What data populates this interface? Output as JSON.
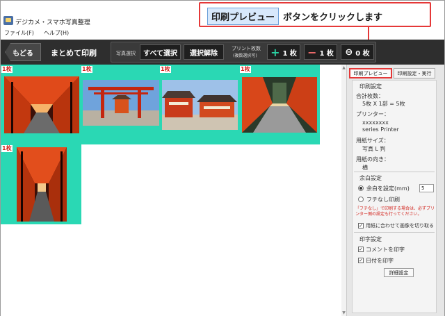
{
  "window": {
    "title": "デジカメ・スマホ写真整理"
  },
  "callout": {
    "button_label": "印刷プレビュー",
    "text": "ボタンをクリックします",
    "color": "#e53838"
  },
  "menu": [
    {
      "label": "ファイル(F)"
    },
    {
      "label": "ヘルプ(H)"
    }
  ],
  "toolbar": {
    "back_label": "もどる",
    "title": "まとめて印刷",
    "photo_select_label": "写真選択",
    "select_all": "すべて選択",
    "deselect": "選択解除",
    "print_count_label": "プリント枚数",
    "print_count_sub": "(複数選択可)",
    "plus_label": "1 枚",
    "minus_label": "1 枚",
    "zero_label": "0 枚",
    "plus_color": "#2ad0a2",
    "minus_color": "#f06c6c"
  },
  "thumbnails": [
    {
      "copies": "1枚",
      "scene": "torii-tunnel-1"
    },
    {
      "copies": "1枚",
      "scene": "torii-gate-sky"
    },
    {
      "copies": "1枚",
      "scene": "shrine-buildings"
    },
    {
      "copies": "1枚",
      "scene": "torii-path-blur"
    },
    {
      "copies": "1枚",
      "scene": "torii-tunnel-2"
    }
  ],
  "side": {
    "tab_preview": "印刷プレビュー",
    "tab_settings": "印刷設定・実行",
    "print_settings_title": "印刷設定",
    "total_label": "合計枚数：",
    "total_value": "5枚 X 1部 = 5枚",
    "printer_label": "プリンター：",
    "printer_value_1": "xxxxxxxx",
    "printer_value_2": "series Printer",
    "paper_size_label": "用紙サイズ：",
    "paper_size_value": "写真 L 判",
    "orientation_label": "用紙の向き：",
    "orientation_value": "横",
    "margin_title": "余白設定",
    "margin_set": "余白を設定(mm)",
    "margin_value": "5",
    "borderless": "フチなし印刷",
    "warning": "「フチなし」で印刷する場合は、必ずプリンター側の設定も行ってください。",
    "fit_crop": "用紙に合わせて画像を切り取る",
    "print_text_title": "印字設定",
    "print_comment": "コメントを印字",
    "print_date": "日付を印字",
    "details_button": "詳細設定"
  }
}
